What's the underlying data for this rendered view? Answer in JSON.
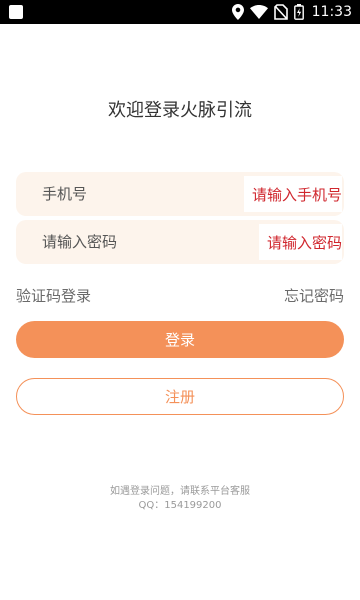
{
  "status_bar": {
    "time": "11:33",
    "icons": [
      "notification-square-icon",
      "location-icon",
      "wifi-icon",
      "no-sim-icon",
      "battery-charging-icon"
    ]
  },
  "title": "欢迎登录火脉引流",
  "phone_field": {
    "placeholder": "手机号",
    "hint": "请输入手机号"
  },
  "password_field": {
    "placeholder": "请输入密码",
    "hint": "请输入密码"
  },
  "links": {
    "sms_login": "验证码登录",
    "forgot_password": "忘记密码"
  },
  "buttons": {
    "login": "登录",
    "register": "注册"
  },
  "footer": {
    "line1": "如遇登录问题，请联系平台客服",
    "line2": "QQ：154199200"
  },
  "colors": {
    "accent": "#f49159",
    "hint": "#d0272e",
    "field_bg": "#fdf4ec"
  }
}
